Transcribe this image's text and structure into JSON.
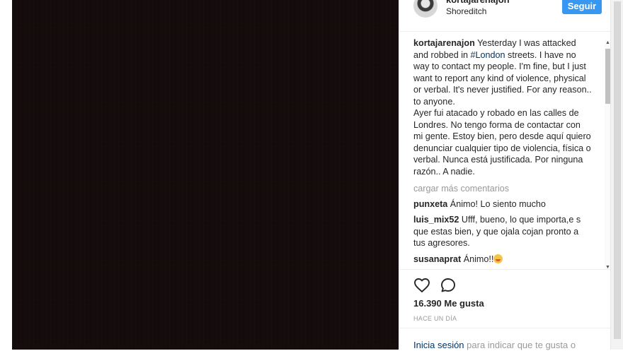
{
  "post": {
    "username": "kortajarenajon",
    "location": "Shoreditch",
    "follow_label": "Seguir"
  },
  "caption": {
    "username": "kortajarenajon",
    "text_before": " Yesterday I was attacked and robbed in ",
    "hashtag": "#London",
    "text_after": " streets. I have no way to contact my people. I'm fine, but I just want to report any kind of violence, physical or verbal. It's never justified. For any reason.. to anyone.",
    "text_es": "Ayer fui atacado y robado en las calles de Londres. No tengo forma de contactar con mi gente. Estoy bien, pero desde aquí quiero denunciar cualquier tipo de violencia, física o verbal. Nunca está justificada. Por ninguna razón.. A nadie."
  },
  "load_more": "cargar más comentarios",
  "comments": [
    {
      "user": "punxeta",
      "text": "Ánimo! Lo siento mucho"
    },
    {
      "user": "luis_mix52",
      "text": "Ufff, bueno, lo que importa,e s que estas bien, y que ojala cojan pronto a tus agresores."
    },
    {
      "user": "susanaprat",
      "text": "Ánimo!!"
    }
  ],
  "actions": {
    "likes": "16.390 Me gusta",
    "time": "HACE UN DÍA",
    "login_link": "Inicia sesión",
    "login_rest": " para indicar que te gusta o"
  },
  "icons": {
    "like": "heart-icon",
    "comment": "comment-icon"
  },
  "colors": {
    "accent": "#3897f0",
    "link": "#003569",
    "muted": "#999999"
  }
}
